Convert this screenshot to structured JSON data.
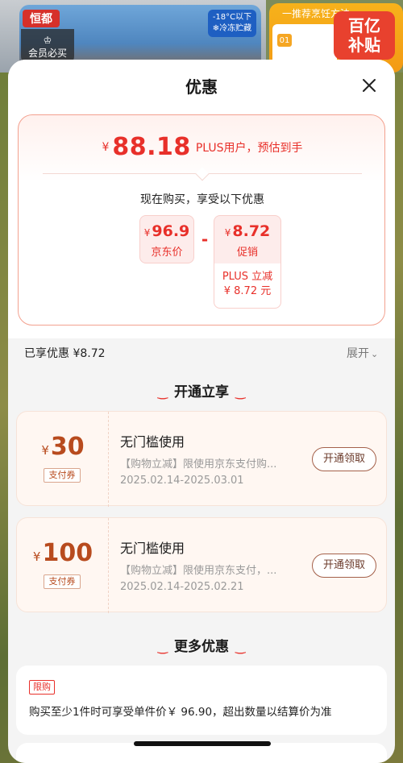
{
  "background": {
    "brand": "恒都",
    "member_label": "会员必买",
    "cold_label": "-18°C以下",
    "cold_sub": "冷冻贮藏",
    "right_header": "一推荐烹饪方法",
    "right_num": "01",
    "subsidy_line1": "百亿",
    "subsidy_line2": "补贴"
  },
  "modal": {
    "title": "优惠",
    "close_icon": "close-icon"
  },
  "price": {
    "currency": "¥",
    "final": "88.18",
    "note": "PLUS用户，预估到手",
    "now_buy": "现在购买，享受以下优惠",
    "jd_price_value": "96.9",
    "jd_price_label": "京东价",
    "minus": "-",
    "promo_value": "8.72",
    "promo_label": "促销",
    "plus_line1": "PLUS 立减",
    "plus_line2": "¥ 8.72 元"
  },
  "summary": {
    "enjoyed": "已享优惠 ¥8.72",
    "expand": "展开"
  },
  "sections": {
    "open_enjoy": "开通立享",
    "more": "更多优惠"
  },
  "coupons": [
    {
      "currency": "¥",
      "amount": "30",
      "tag": "支付券",
      "title": "无门槛使用",
      "desc": "【购物立减】限使用京东支付购...",
      "date": "2025.02.14-2025.03.01",
      "button": "开通领取"
    },
    {
      "currency": "¥",
      "amount": "100",
      "tag": "支付券",
      "title": "无门槛使用",
      "desc": "【购物立减】限使用京东支付，...",
      "date": "2025.02.14-2025.02.21",
      "button": "开通领取"
    }
  ],
  "more": {
    "tag": "限购",
    "text": "购买至少1件时可享受单件价￥ 96.90，超出数量以结算价为准"
  },
  "colors": {
    "accent": "#e8302a",
    "coupon_bg": "#fff7f2",
    "button_border": "#a4604a"
  }
}
